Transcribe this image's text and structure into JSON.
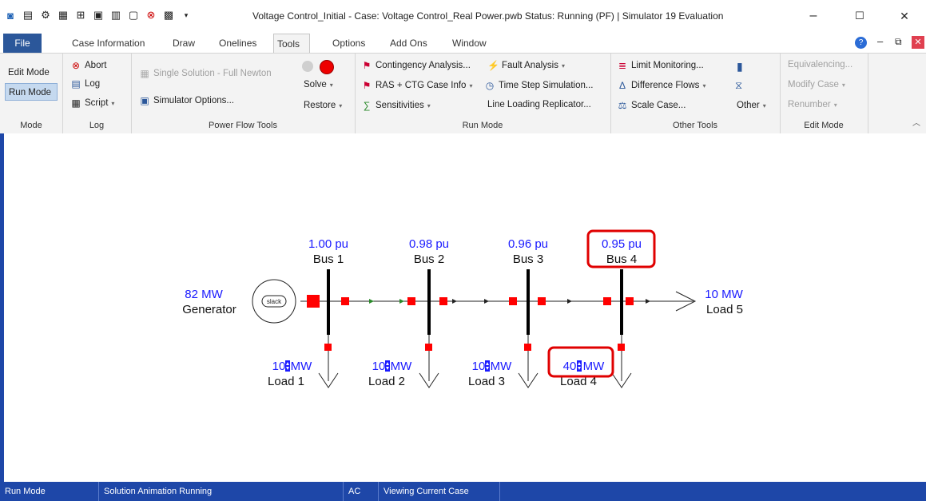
{
  "window": {
    "title": "Voltage Control_Initial - Case: Voltage Control_Real Power.pwb  Status: Running (PF) | Simulator 19 Evaluation",
    "minimize": "–",
    "maximize": "☐",
    "close": "✕"
  },
  "tabs": [
    "File",
    "Case Information",
    "Draw",
    "Onelines",
    "Tools",
    "Options",
    "Add Ons",
    "Window"
  ],
  "ribbon": {
    "mode": {
      "edit": "Edit Mode",
      "run": "Run Mode",
      "label": "Mode"
    },
    "log": {
      "abort": "Abort",
      "log": "Log",
      "script": "Script",
      "label": "Log"
    },
    "power_flow": {
      "single_solution": "Single Solution - Full Newton",
      "simulator_options": "Simulator Options...",
      "solve": "Solve",
      "restore": "Restore",
      "label": "Power Flow Tools"
    },
    "run_mode": {
      "contingency": "Contingency Analysis...",
      "fault": "Fault Analysis",
      "ras": "RAS + CTG Case Info",
      "time_step": "Time Step Simulation...",
      "sensitivities": "Sensitivities",
      "line_loading": "Line Loading Replicator...",
      "label": "Run Mode"
    },
    "other_tools": {
      "limit": "Limit Monitoring...",
      "difference": "Difference Flows",
      "scale": "Scale Case...",
      "other": "Other",
      "label": "Other Tools"
    },
    "edit_mode": {
      "equivalencing": "Equivalencing...",
      "modify": "Modify Case",
      "renumber": "Renumber",
      "label": "Edit Mode"
    }
  },
  "oneline": {
    "buses": [
      {
        "name": "Bus 1",
        "voltage": "1.00 pu"
      },
      {
        "name": "Bus 2",
        "voltage": "0.98 pu"
      },
      {
        "name": "Bus 3",
        "voltage": "0.96 pu"
      },
      {
        "name": "Bus 4",
        "voltage": "0.95 pu"
      }
    ],
    "generator": {
      "name": "Generator",
      "output": "82 MW",
      "symbol": "slack"
    },
    "loads": [
      {
        "name": "Load 1",
        "value": "10",
        "unit": "MW"
      },
      {
        "name": "Load 2",
        "value": "10",
        "unit": "MW"
      },
      {
        "name": "Load 3",
        "value": "10",
        "unit": "MW"
      },
      {
        "name": "Load 4",
        "value": "40",
        "unit": "MW"
      }
    ],
    "load5": {
      "name": "Load 5",
      "value": "10 MW"
    }
  },
  "status_bar": [
    "Run Mode",
    "Solution Animation Running",
    "AC",
    "Viewing Current Case"
  ],
  "colors": {
    "accent": "#2b579a",
    "status": "#1e47a8",
    "value_text": "#1a1aff",
    "highlight": "#e00000",
    "node": "#ff0000"
  }
}
